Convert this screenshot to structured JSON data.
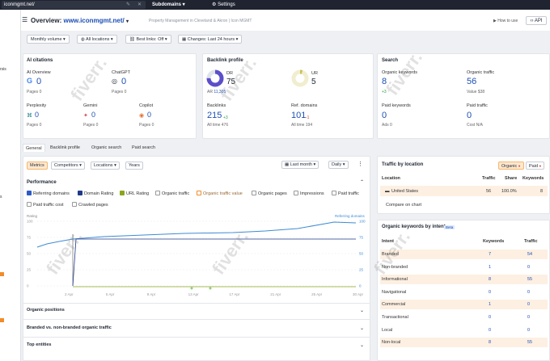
{
  "topbar": {
    "url": "iconmgmt.net/",
    "mode": "Subdomains",
    "settings": "Settings"
  },
  "leftbar": {
    "frag1": "rsis",
    "frag2": "s"
  },
  "header": {
    "title_prefix": "Overview:",
    "title_domain": "www.iconmgmt.net/",
    "subtitle": "Property Management in Cleveland & Akron | Icon MGMT",
    "howto": "How to use",
    "api": "API"
  },
  "filters": [
    "Monthly volume",
    "All locations",
    "Best links: Off",
    "Changes: Last 24 hours"
  ],
  "ai": {
    "title": "AI citations",
    "items": [
      {
        "name": "AI Overview",
        "value": "0",
        "sub": "Pages 0"
      },
      {
        "name": "ChatGPT",
        "value": "0",
        "sub": "Pages 0"
      },
      {
        "name": "Perplexity",
        "value": "0",
        "sub": "Pages 0"
      },
      {
        "name": "Gemini",
        "value": "0",
        "sub": "Pages 0"
      },
      {
        "name": "Copilot",
        "value": "0",
        "sub": "Pages 0"
      }
    ]
  },
  "backlink": {
    "title": "Backlink profile",
    "dr_label": "DR",
    "dr": "75",
    "ar_label": "AR",
    "ar": "11,305",
    "ur_label": "UR",
    "ur": "5",
    "backlinks_label": "Backlinks",
    "backlinks": "215",
    "backlinks_delta": "+3",
    "backlinks_all": "All time 476",
    "refdom_label": "Ref. domains",
    "refdom": "101",
    "refdom_delta": "-1",
    "refdom_all": "All time 194"
  },
  "search": {
    "title": "Search",
    "ok_label": "Organic keywords",
    "ok": "8",
    "ok_delta": "+3",
    "ot_label": "Organic traffic",
    "ot": "56",
    "ot_sub": "Value $38",
    "pk_label": "Paid keywords",
    "pk": "0",
    "pk_sub": "Ads 0",
    "pt_label": "Paid traffic",
    "pt": "0",
    "pt_sub": "Cost N/A"
  },
  "tabs": [
    "General",
    "Backlink profile",
    "Organic search",
    "Paid search"
  ],
  "metrics": {
    "buttons": [
      "Metrics",
      "Competitors",
      "Locations",
      "Years"
    ],
    "range": "Last month",
    "interval": "Daily",
    "section": "Performance",
    "checks": [
      "Referring domains",
      "Domain Rating",
      "URL Rating",
      "Organic traffic",
      "Organic traffic value",
      "Organic pages",
      "Impressions",
      "Paid traffic",
      "Paid traffic cost",
      "Crawled pages"
    ],
    "ylabel": "Rating",
    "legend": "Referring domains",
    "left_ticks": [
      "100",
      "75",
      "50",
      "25",
      "0"
    ],
    "right_ticks": [
      "100",
      "75",
      "50",
      "25",
      "0"
    ],
    "xticks": [
      "2 Apr",
      "5 Apr",
      "9 Apr",
      "13 Apr",
      "17 Apr",
      "21 Apr",
      "25 Apr",
      "30 Apr"
    ]
  },
  "sections": [
    "Organic positions",
    "Branded vs. non-branded organic traffic",
    "Top entities"
  ],
  "traffic_location": {
    "title": "Traffic by location",
    "toggle": [
      "Organic",
      "Paid"
    ],
    "headers": [
      "Location",
      "Traffic",
      "Share",
      "Keywords"
    ],
    "rows": [
      {
        "loc": "United States",
        "traffic": "56",
        "share": "100.0%",
        "kw": "8"
      }
    ],
    "compare": "Compare on chart"
  },
  "intent": {
    "title": "Organic keywords by intent",
    "beta": "Beta",
    "headers": [
      "Intent",
      "Keywords",
      "Traffic"
    ],
    "rows": [
      {
        "intent": "Branded",
        "kw": "7",
        "tr": "54",
        "hl": true
      },
      {
        "intent": "Non-branded",
        "kw": "1",
        "tr": "0",
        "hl": false
      },
      {
        "intent": "Informational",
        "kw": "8",
        "tr": "55",
        "hl": true
      },
      {
        "intent": "Navigational",
        "kw": "0",
        "tr": "0",
        "hl": false
      },
      {
        "intent": "Commercial",
        "kw": "1",
        "tr": "0",
        "hl": true
      },
      {
        "intent": "Transactional",
        "kw": "0",
        "tr": "0",
        "hl": false
      },
      {
        "intent": "Local",
        "kw": "0",
        "tr": "0",
        "hl": false
      },
      {
        "intent": "Non-local",
        "kw": "8",
        "tr": "55",
        "hl": true
      }
    ]
  },
  "watermark": "fiverr.",
  "colors": {
    "accent": "#1c4fb5",
    "highlight": "#fdf0e2",
    "ref": "#3d8bd4",
    "dr": "#1f3a8a",
    "ur": "#8aa51e"
  }
}
